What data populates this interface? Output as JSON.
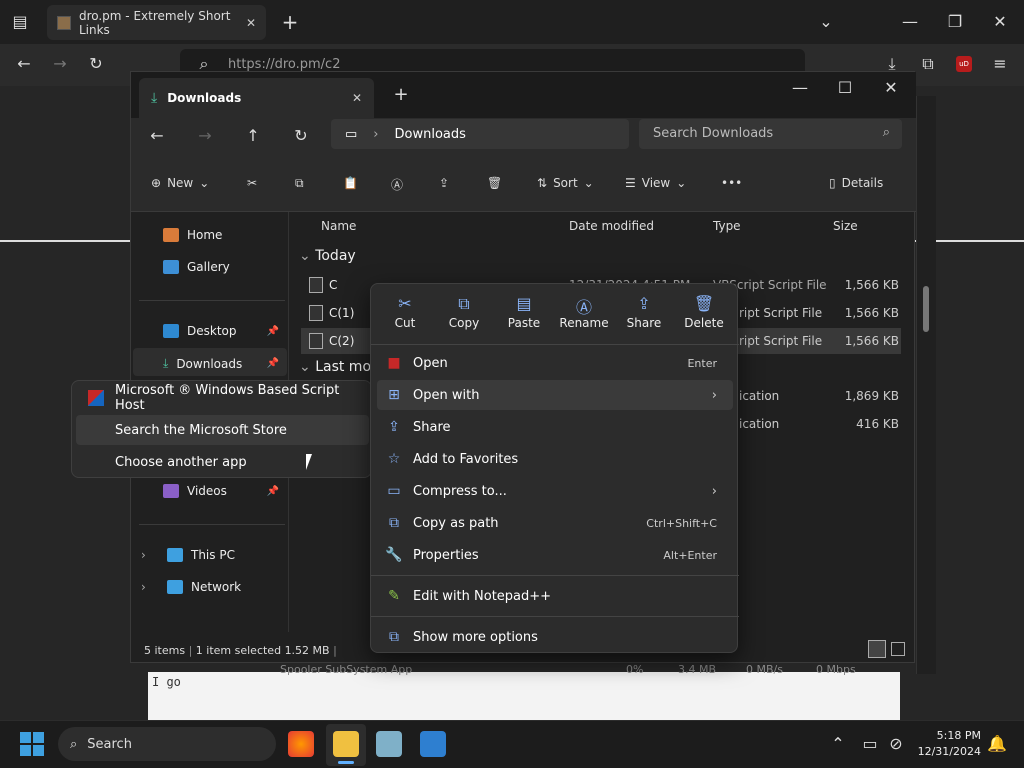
{
  "browser": {
    "tab_title": "dro.pm - Extremely Short Links",
    "url": "https://dro.pm/c2",
    "ext_badge": "uD"
  },
  "page": {
    "text": "I go"
  },
  "explorer": {
    "tab_title": "Downloads",
    "address": "Downloads",
    "search_placeholder": "Search Downloads",
    "toolbar": {
      "new": "New",
      "sort": "Sort",
      "view": "View",
      "details": "Details"
    },
    "sidebar": {
      "home": "Home",
      "gallery": "Gallery",
      "desktop": "Desktop",
      "downloads": "Downloads",
      "videos": "Videos",
      "this_pc": "This PC",
      "network": "Network"
    },
    "columns": {
      "name": "Name",
      "date": "Date modified",
      "type": "Type",
      "size": "Size"
    },
    "groups": {
      "today": "Today",
      "last_month": "Last mon"
    },
    "files": [
      {
        "name": "C",
        "date": "12/31/2024 4:51 PM",
        "type": "VBScript Script File",
        "size": "1,566 KB"
      },
      {
        "name": "C(1)",
        "type": "ript Script File",
        "size": "1,566 KB"
      },
      {
        "name": "C(2)",
        "type": "ript Script File",
        "size": "1,566 KB"
      },
      {
        "type": "ication",
        "size": "1,869 KB"
      },
      {
        "type": "ication",
        "size": "416 KB"
      }
    ],
    "status": {
      "items": "5 items",
      "selected": "1 item selected",
      "size": "1.52 MB"
    }
  },
  "context_menu": {
    "quick_actions": [
      "Cut",
      "Copy",
      "Paste",
      "Rename",
      "Share",
      "Delete"
    ],
    "items": [
      {
        "label": "Open",
        "shortcut": "Enter"
      },
      {
        "label": "Open with"
      },
      {
        "label": "Share"
      },
      {
        "label": "Add to Favorites"
      },
      {
        "label": "Compress to..."
      },
      {
        "label": "Copy as path",
        "shortcut": "Ctrl+Shift+C"
      },
      {
        "label": "Properties",
        "shortcut": "Alt+Enter"
      },
      {
        "label": "Edit with Notepad++"
      },
      {
        "label": "Show more options"
      }
    ]
  },
  "submenu": {
    "items": [
      "Microsoft ® Windows Based Script Host",
      "Search the Microsoft Store",
      "Choose another app"
    ]
  },
  "background_row": {
    "name": "Spooler SubSystem App",
    "cpu": "0%",
    "mem": "3.4 MB",
    "disk": "0 MB/s",
    "net": "0 Mbps"
  },
  "taskbar": {
    "search": "Search",
    "time": "5:18 PM",
    "date": "12/31/2024"
  }
}
